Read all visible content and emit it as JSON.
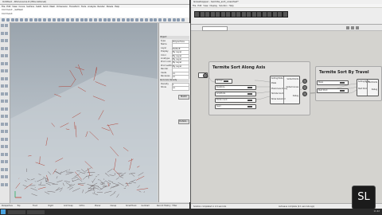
{
  "rhino": {
    "title": "Untitled - Rhinoceros 6 (Educational)",
    "menu": [
      "File",
      "Edit",
      "View",
      "Curve",
      "Surface",
      "SubD",
      "Solid",
      "Mesh",
      "Dimension",
      "Transform",
      "Tools",
      "Analyze",
      "Render",
      "Panels",
      "Help"
    ],
    "command_lines": [
      "Command: _SelMesh",
      "Command:"
    ],
    "viewport_label": "Perspective",
    "properties": {
      "header_object": "Object",
      "rows": [
        {
          "k": "Type",
          "v": "Polysurface"
        },
        {
          "k": "Name",
          "v": ""
        },
        {
          "k": "Layer",
          "v": "Default"
        },
        {
          "k": "Display",
          "v": "By Layer"
        },
        {
          "k": "Color",
          "v": "By Layer"
        },
        {
          "k": "Linetype",
          "v": "By Layer"
        },
        {
          "k": "Print color",
          "v": "By Layer"
        },
        {
          "k": "Print width",
          "v": "By Layer"
        },
        {
          "k": "Render",
          "v": ""
        },
        {
          "k": "Casts",
          "v": "on"
        },
        {
          "k": "Receives",
          "v": "on"
        }
      ],
      "header_isocurve": "Isocurve density",
      "iso_rows": [
        {
          "k": "Density",
          "v": "1"
        },
        {
          "k": "Show",
          "v": "on"
        }
      ],
      "match_label": "Match",
      "details_label": "Details..."
    },
    "status": [
      "Perspective",
      "Top",
      "Front",
      "Right",
      "Grid Snap",
      "Ortho",
      "Planar",
      "Osnap",
      "SmartTrack",
      "Gumball",
      "Record History",
      "Filter"
    ]
  },
  "grasshopper": {
    "title": "Grasshopper - termite_sort_unsorted*",
    "menu": [
      "File",
      "Edit",
      "View",
      "Display",
      "Solution",
      "Help"
    ],
    "group_axis_title": "Termite Sort Along Axis",
    "group_travel_title": "Termite Sort By Travel",
    "axis_component_inputs": [
      "Sorting Mode",
      "Pixels",
      "Pheromone Decay",
      "Termite Count",
      "Noise Generator"
    ],
    "axis_component_outputs": [
      "Sorted Points",
      "Sorted Curves",
      "Debug"
    ],
    "axis_slider_labels": [
      "Domain",
      "Iterations",
      "Amplitude",
      "Points count",
      "Seed"
    ],
    "travel_component_inputs": [
      "Sorting Mode",
      "Start Point"
    ],
    "travel_component_outputs": [
      "Sorted Points",
      "Debug"
    ],
    "travel_slider_labels": [
      "Steps",
      "Start Point"
    ],
    "status_left": "Solution completed in 2.9 seconds",
    "status_right": "Autosave complete (0.1 seconds ago)"
  },
  "logo": "SL",
  "taskbar_clock": "11:42",
  "colors": {
    "mesh": "#b0382a",
    "viewport_bg": "#bfc7cf",
    "canvas_bg": "#d4d3cf"
  }
}
